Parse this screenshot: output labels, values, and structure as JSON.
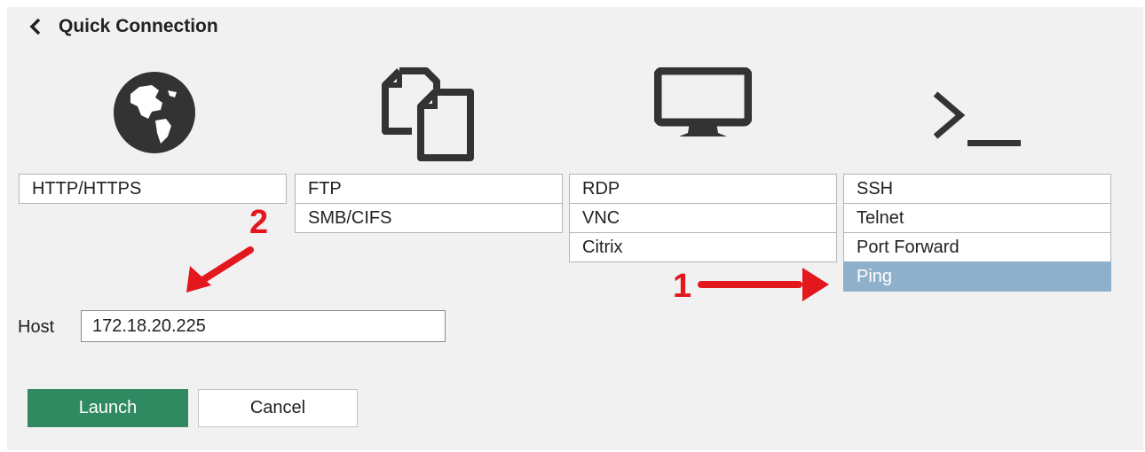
{
  "header": {
    "title": "Quick Connection"
  },
  "icons": {
    "web": "globe-icon",
    "file": "files-icon",
    "desktop": "monitor-icon",
    "terminal": "terminal-icon"
  },
  "columns": {
    "web": [
      "HTTP/HTTPS"
    ],
    "file": [
      "FTP",
      "SMB/CIFS"
    ],
    "desktop": [
      "RDP",
      "VNC",
      "Citrix"
    ],
    "terminal": [
      "SSH",
      "Telnet",
      "Port Forward",
      "Ping"
    ]
  },
  "selected": "Ping",
  "host": {
    "label": "Host",
    "value": "172.18.20.225"
  },
  "buttons": {
    "launch": "Launch",
    "cancel": "Cancel"
  },
  "annotations": {
    "step1": "1",
    "step2": "2"
  },
  "colors": {
    "accent_green": "#2f8a62",
    "selected_row": "#8fb0cb",
    "annotation_red": "#e3181f",
    "panel_bg": "#f1f1f1"
  }
}
